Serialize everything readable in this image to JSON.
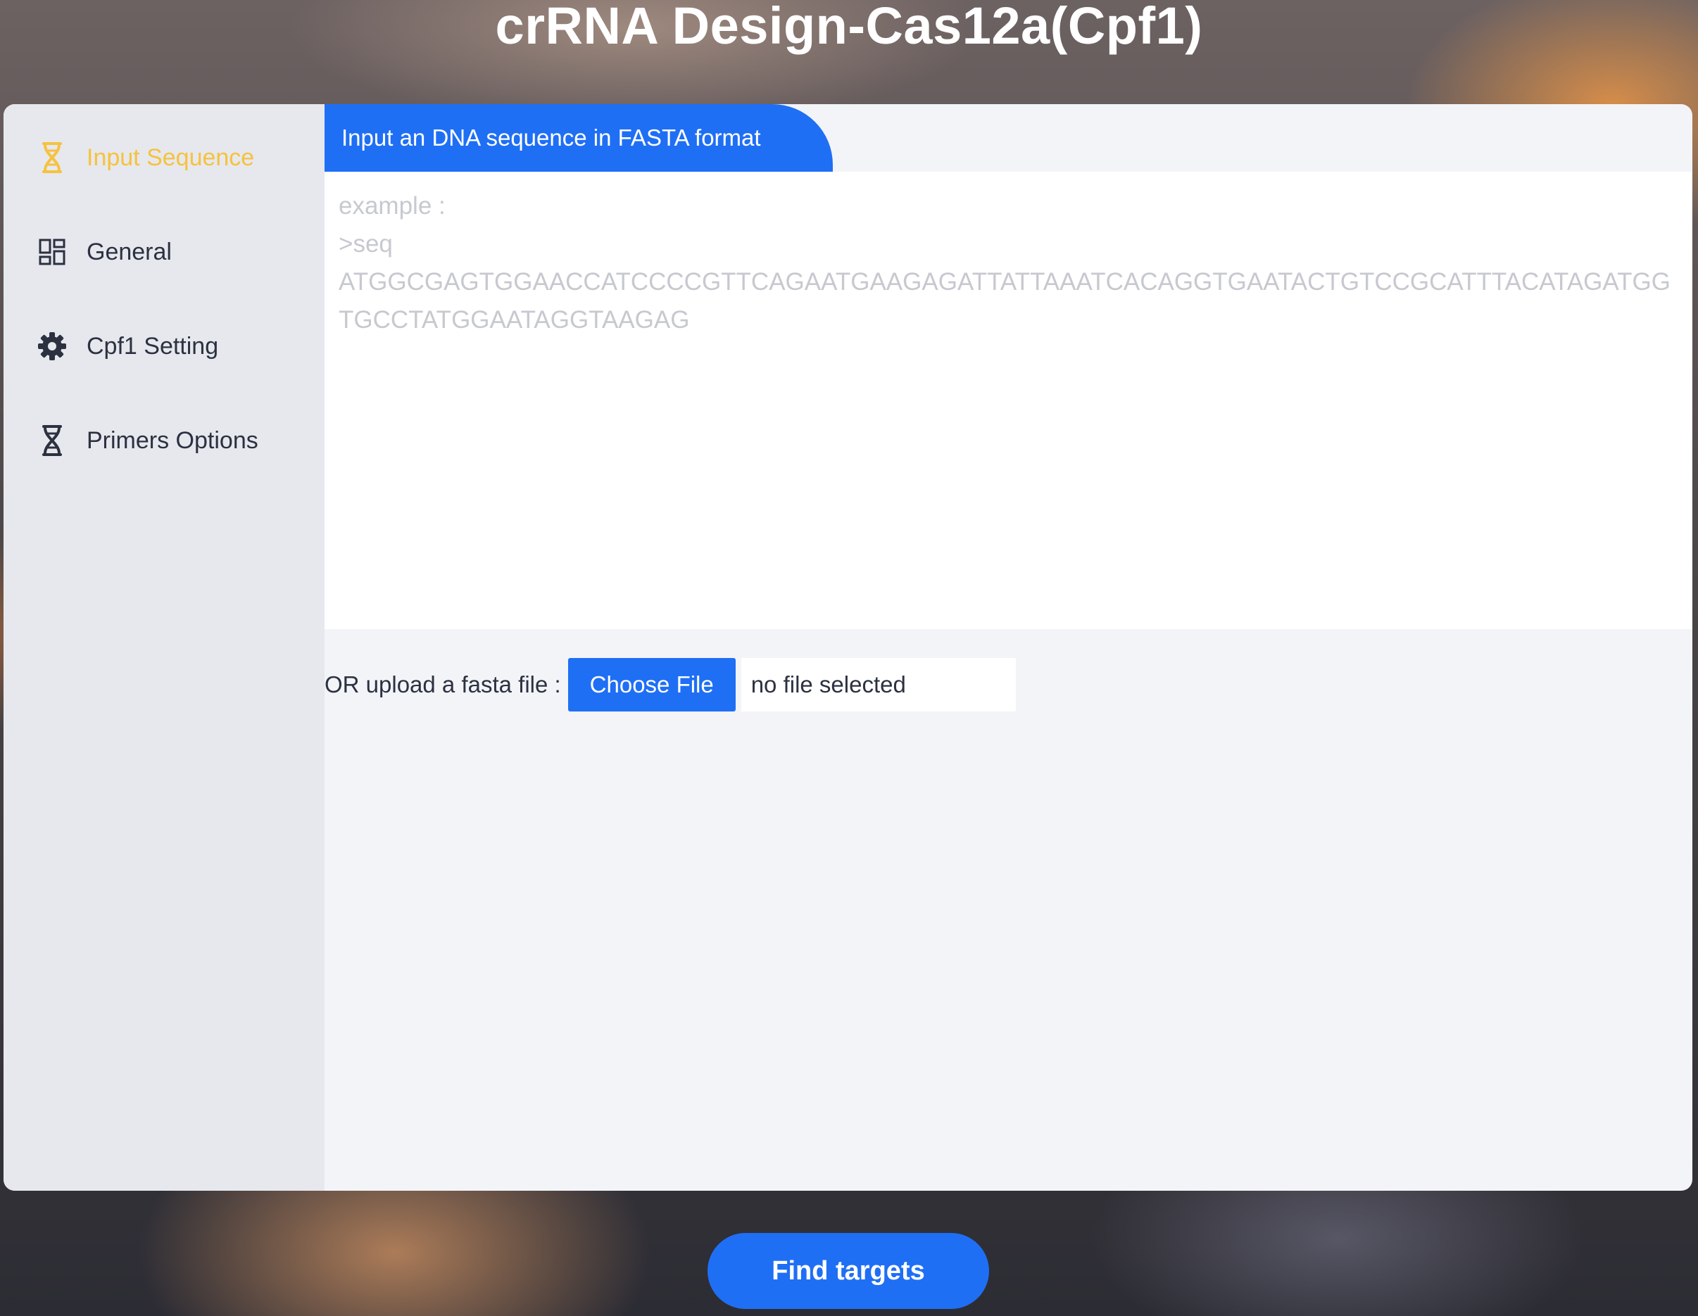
{
  "page": {
    "title": "crRNA Design-Cas12a(Cpf1)"
  },
  "sidebar": {
    "items": [
      {
        "label": "Input Sequence",
        "icon": "dna-icon",
        "active": true
      },
      {
        "label": "General",
        "icon": "dashboard-grid-icon",
        "active": false
      },
      {
        "label": "Cpf1 Setting",
        "icon": "gear-icon",
        "active": false
      },
      {
        "label": "Primers Options",
        "icon": "dna-icon",
        "active": false
      }
    ]
  },
  "main": {
    "tab_label": "Input an DNA sequence in FASTA format",
    "sequence_input": {
      "value": "",
      "placeholder": "example :\n>seq\nATGGCGAGTGGAACCATCCCCGTTCAGAATGAAGAGATTATTAAATCACAGGTGAATACTGTCCGCATTTACATAGATGGTGCCTATGGAATAGGTAAGAG"
    },
    "upload": {
      "label": "OR upload a fasta file :",
      "button_label": "Choose File",
      "status": "no file selected"
    }
  },
  "actions": {
    "find_targets_label": "Find targets"
  },
  "colors": {
    "accent_blue": "#1f6ff5",
    "active_yellow": "#f6c23e",
    "sidebar_bg": "#e6e8ee",
    "panel_bg": "#f2f4f8",
    "text_dark": "#2c3140"
  }
}
